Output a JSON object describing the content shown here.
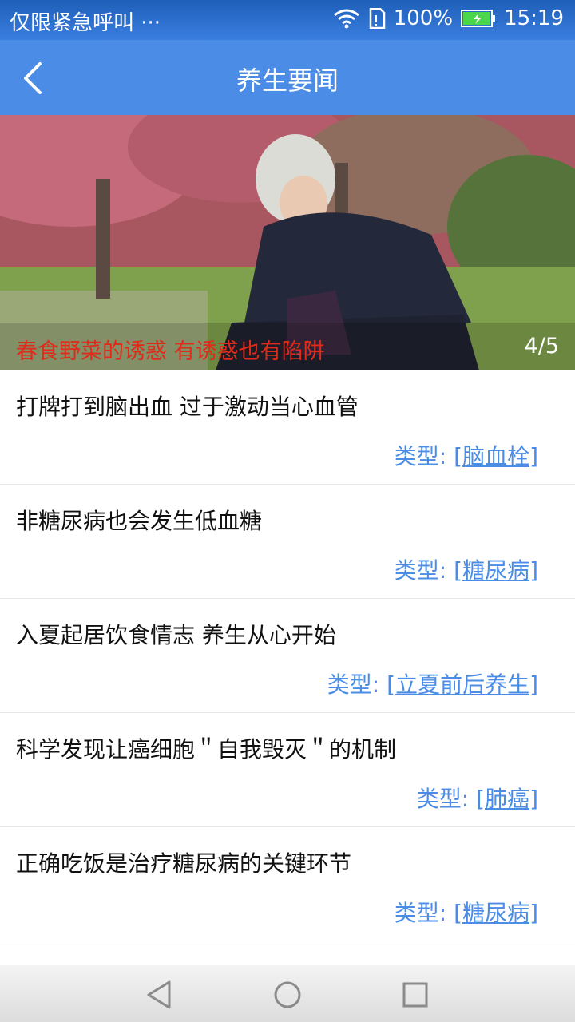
{
  "status": {
    "carrier": "仅限紧急呼叫",
    "more": "···",
    "battery": "100%",
    "time": "15:19"
  },
  "header": {
    "title": "养生要闻"
  },
  "banner": {
    "caption": "春食野菜的诱惑 有诱惑也有陷阱",
    "index": "4/5"
  },
  "list": {
    "type_label": "类型:",
    "items": [
      {
        "title": "打牌打到脑出血 过于激动当心血管",
        "tag": "[脑血栓]"
      },
      {
        "title": "非糖尿病也会发生低血糖",
        "tag": "[糖尿病]"
      },
      {
        "title": "入夏起居饮食情志 养生从心开始",
        "tag": "[立夏前后养生]"
      },
      {
        "title": "科学发现让癌细胞＂自我毁灭＂的机制",
        "tag": "[肺癌]"
      },
      {
        "title": "正确吃饭是治疗糖尿病的关键环节",
        "tag": "[糖尿病]"
      }
    ]
  },
  "colors": {
    "accent": "#4a8ce6",
    "caption": "#e02a1a"
  }
}
